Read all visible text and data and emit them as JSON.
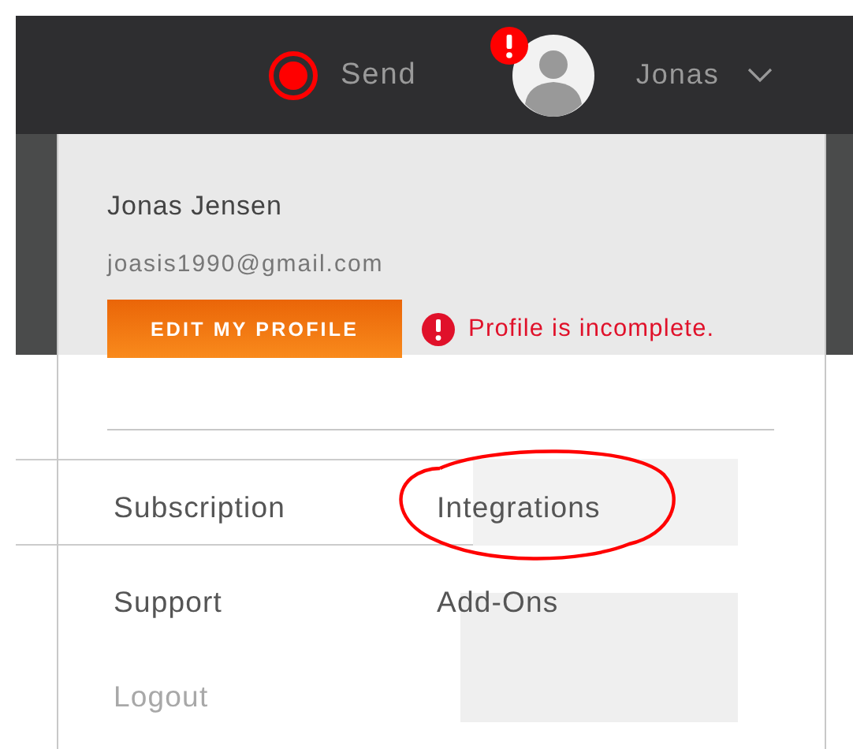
{
  "header": {
    "send_label": "Send",
    "user_name": "Jonas",
    "alert": true
  },
  "account_menu": {
    "full_name": "Jonas Jensen",
    "email": "joasis1990@gmail.com",
    "edit_button": "EDIT MY PROFILE",
    "warning": "Profile is incomplete.",
    "items": [
      {
        "label": "Subscription",
        "disabled": false,
        "highlighted": false
      },
      {
        "label": "Integrations",
        "disabled": false,
        "highlighted": true
      },
      {
        "label": "Support",
        "disabled": false,
        "highlighted": false
      },
      {
        "label": "Add-Ons",
        "disabled": false,
        "highlighted": false
      },
      {
        "label": "Logout",
        "disabled": true,
        "highlighted": false
      }
    ]
  }
}
